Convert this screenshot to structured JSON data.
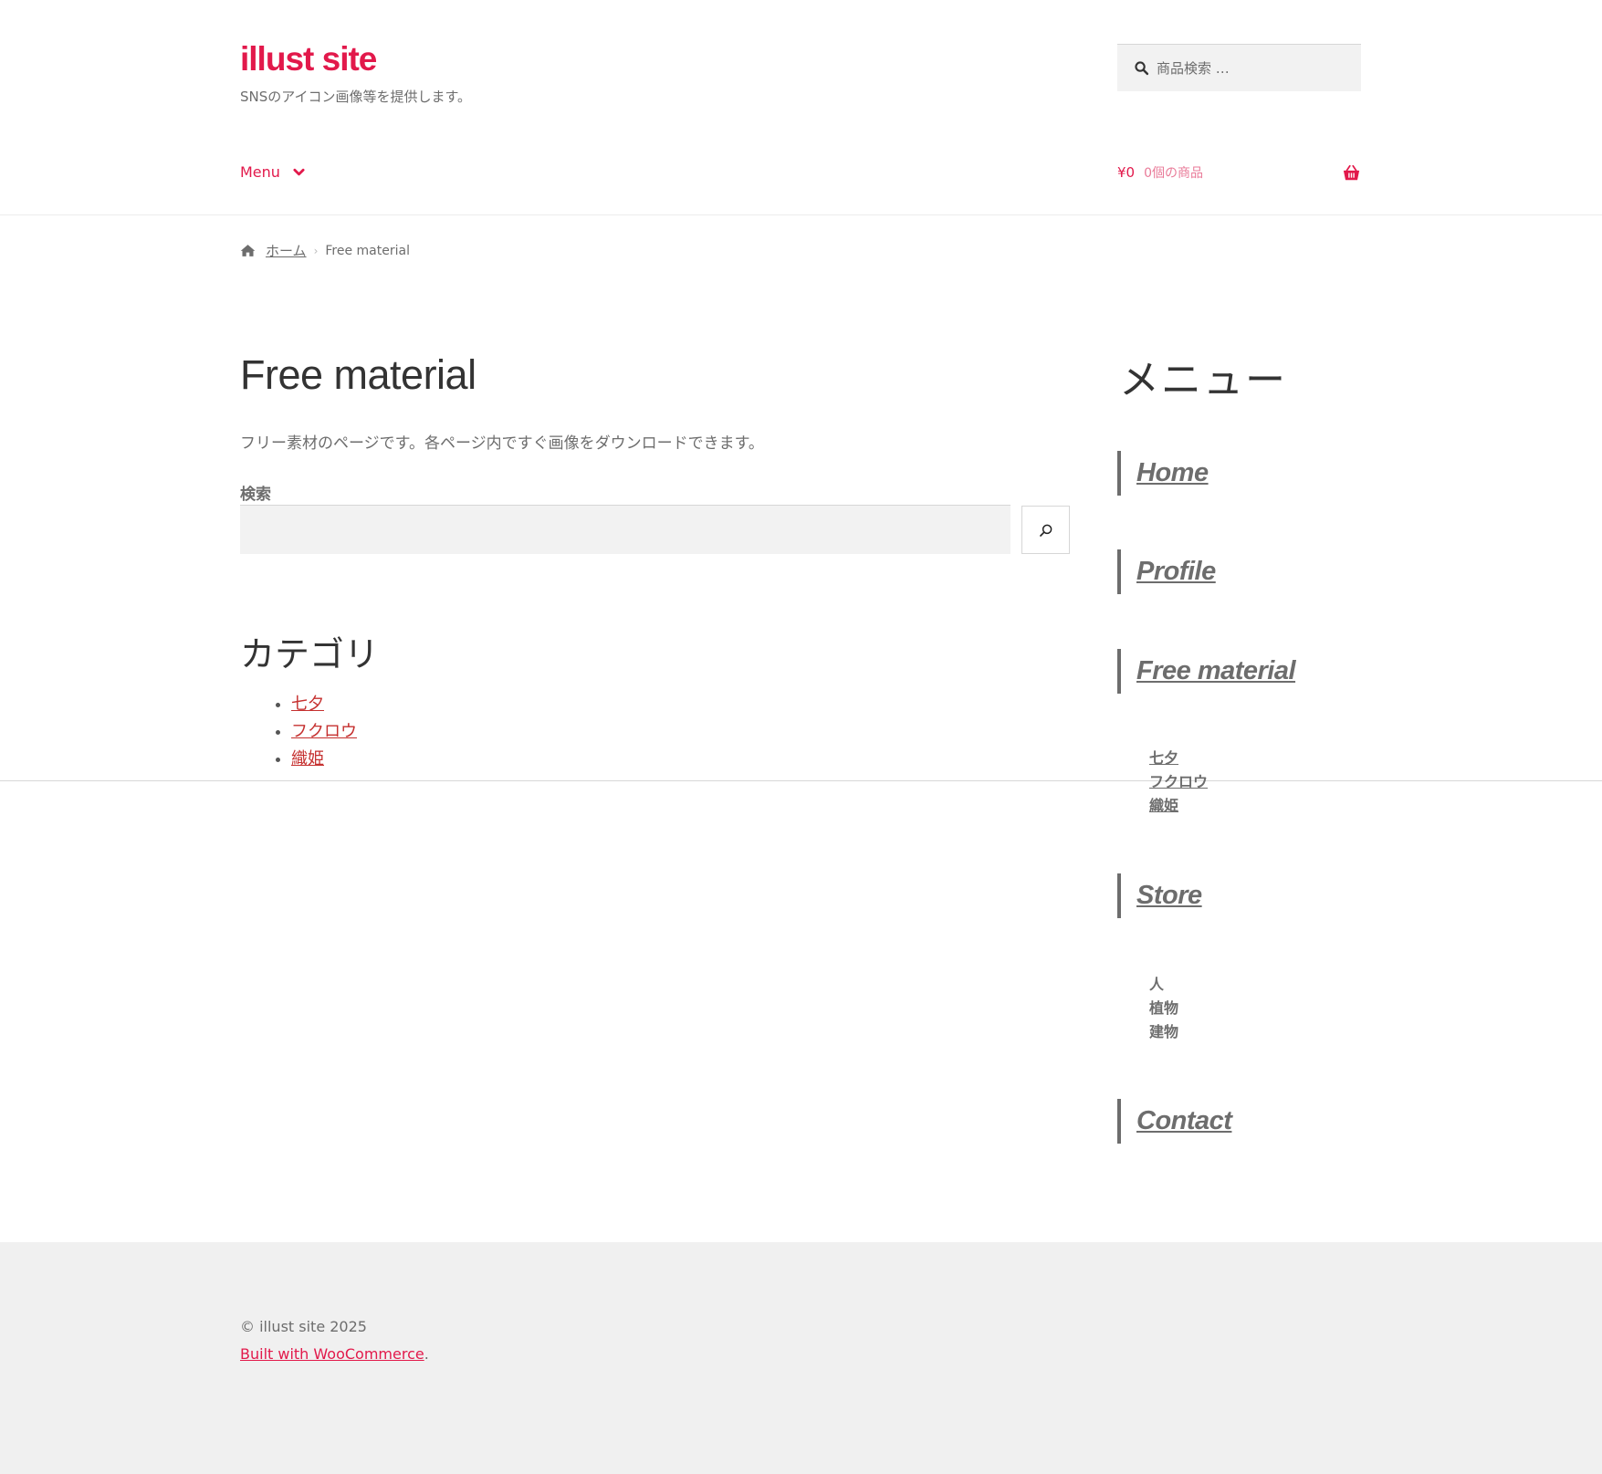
{
  "header": {
    "site_title": "illust site",
    "tagline": "SNSのアイコン画像等を提供します。",
    "product_search_placeholder": "商品検索 …",
    "menu_label": "Menu",
    "cart_amount": "¥0",
    "cart_count": "0個の商品"
  },
  "breadcrumb": {
    "home": "ホーム",
    "current": "Free material"
  },
  "main": {
    "title": "Free material",
    "intro": "フリー素材のページです。各ページ内ですぐ画像をダウンロードできます。",
    "search_label": "検索",
    "search_value": "",
    "categories_heading": "カテゴリ",
    "categories": [
      "七夕",
      "フクロウ",
      "織姫"
    ]
  },
  "sidebar": {
    "heading": "メニュー",
    "items": [
      {
        "label": "Home"
      },
      {
        "label": "Profile"
      },
      {
        "label": "Free material",
        "children": [
          "七夕",
          "フクロウ",
          "織姫"
        ]
      },
      {
        "label": "Store",
        "children": [
          "人",
          "植物",
          "建物"
        ]
      },
      {
        "label": "Contact"
      }
    ]
  },
  "footer": {
    "copyright": "© illust site 2025",
    "built_link": "Built with WooCommerce",
    "built_suffix": "."
  },
  "colors": {
    "accent": "#e2194b",
    "text": "#6d6d6d",
    "heading": "#333333",
    "category_link": "#c5302f",
    "footer_bg": "#f0f0f0"
  }
}
